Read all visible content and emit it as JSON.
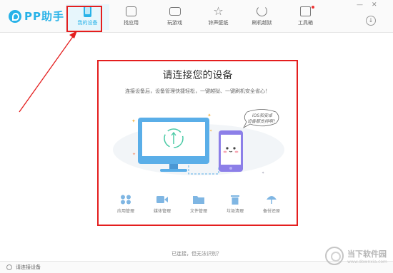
{
  "app": {
    "name": "PP助手"
  },
  "nav": {
    "items": [
      {
        "label": "我的设备",
        "icon": "phone-icon"
      },
      {
        "label": "找应用",
        "icon": "bag-icon"
      },
      {
        "label": "玩游戏",
        "icon": "gamepad-icon"
      },
      {
        "label": "铃声壁纸",
        "icon": "star-icon"
      },
      {
        "label": "刷机越狱",
        "icon": "refresh-icon"
      },
      {
        "label": "工具箱",
        "icon": "toolbox-icon"
      }
    ],
    "active_index": 0
  },
  "window_controls": {
    "minimize": "—",
    "close": "✕",
    "download": "↓"
  },
  "panel": {
    "title": "请连接您的设备",
    "subtitle": "连接设备后，设备管理快捷轻松，一键越狱、一键刷机安全省心！",
    "bubble_line1": "iOS和安卓",
    "bubble_line2": "设备都支持啊！",
    "tools": [
      {
        "label": "应用管理",
        "icon": "apps-icon"
      },
      {
        "label": "媒体管理",
        "icon": "video-icon"
      },
      {
        "label": "文件管理",
        "icon": "folder-icon"
      },
      {
        "label": "垃圾清理",
        "icon": "trash-icon"
      },
      {
        "label": "备份还原",
        "icon": "umbrella-icon"
      }
    ]
  },
  "footer": {
    "connection_link": "已连接，但无法识别？",
    "status_text": "请连接设备"
  },
  "watermark": {
    "title": "当下软件园",
    "url": "www.downxia.com"
  },
  "colors": {
    "accent": "#27b2e8",
    "highlight_red": "#e41e1e",
    "device_blue": "#5aaee8",
    "phone_purple": "#8c7fe8"
  }
}
